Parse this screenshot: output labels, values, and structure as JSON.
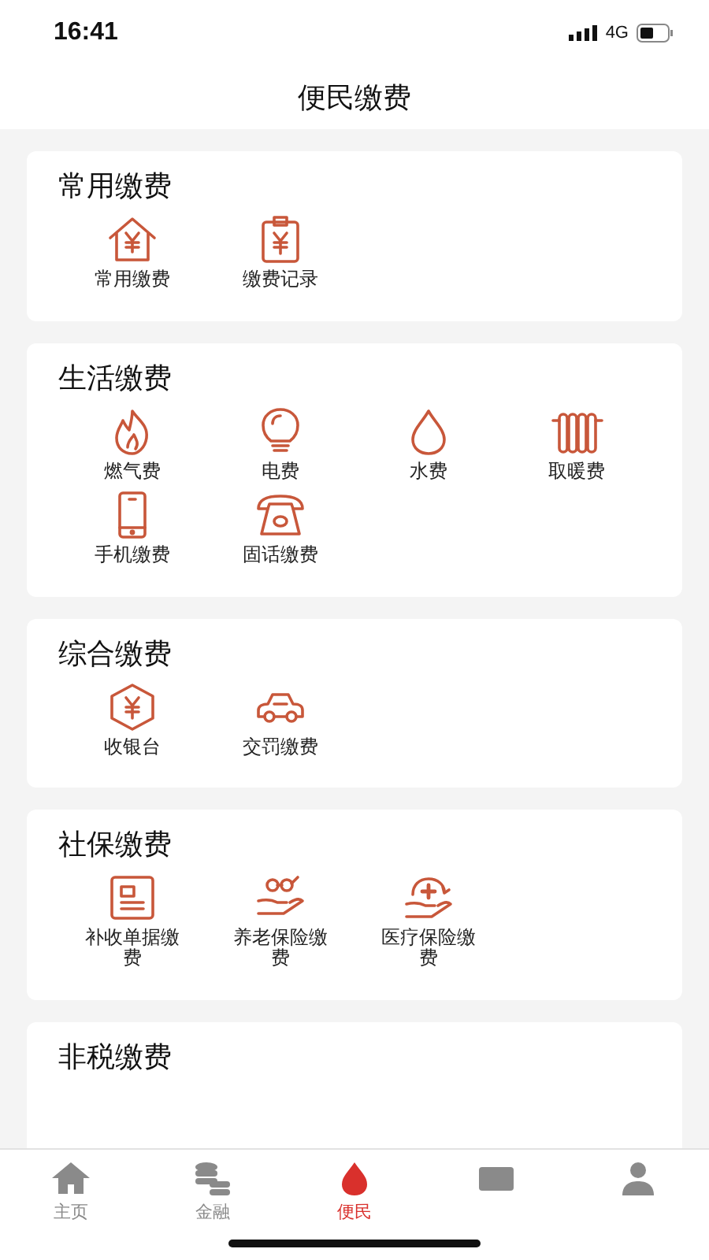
{
  "status_bar": {
    "time": "16:41",
    "network": "4G"
  },
  "header": {
    "title": "便民缴费"
  },
  "sections": [
    {
      "title": "常用缴费",
      "items": [
        {
          "label": "常用缴费"
        },
        {
          "label": "缴费记录"
        }
      ]
    },
    {
      "title": "生活缴费",
      "items": [
        {
          "label": "燃气费"
        },
        {
          "label": "电费"
        },
        {
          "label": "水费"
        },
        {
          "label": "取暖费"
        },
        {
          "label": "手机缴费"
        },
        {
          "label": "固话缴费"
        }
      ]
    },
    {
      "title": "综合缴费",
      "items": [
        {
          "label": "收银台"
        },
        {
          "label": "交罚缴费"
        }
      ]
    },
    {
      "title": "社保缴费",
      "items": [
        {
          "label": "补收单据缴费"
        },
        {
          "label": "养老保险缴费"
        },
        {
          "label": "医疗保险缴费"
        }
      ]
    },
    {
      "title": "非税缴费"
    }
  ],
  "tab_bar": [
    {
      "label": "主页",
      "selected": false
    },
    {
      "label": "金融",
      "selected": false
    },
    {
      "label": "便民",
      "selected": true
    },
    {
      "selected": false
    },
    {
      "selected": false
    }
  ]
}
